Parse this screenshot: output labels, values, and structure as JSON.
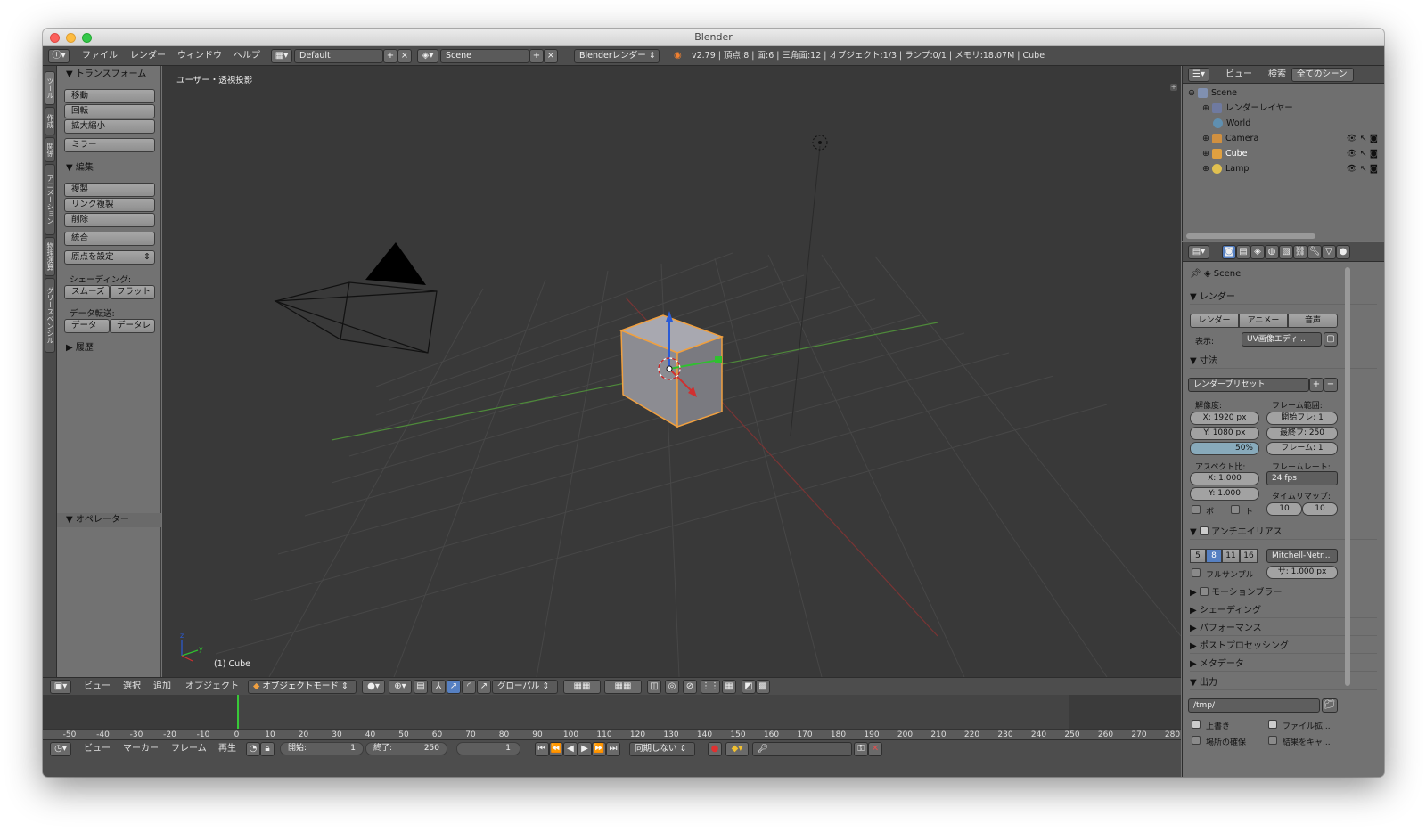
{
  "window": {
    "title": "Blender"
  },
  "header": {
    "menus": [
      "ファイル",
      "レンダー",
      "ウィンドウ",
      "ヘルプ"
    ],
    "layout": "Default",
    "scene": "Scene",
    "engine": "Blenderレンダー",
    "stats": "v2.79 | 頂点:8 | 面:6 | 三角面:12 | オブジェクト:1/3 | ランプ:0/1 | メモリ:18.07M | Cube"
  },
  "lefttabs": [
    "ツール",
    "作成",
    "関係",
    "アニメーション",
    "物理演算",
    "グリースペンシル"
  ],
  "tools": {
    "transform_header": "▼ トランスフォーム",
    "move": "移動",
    "rotate": "回転",
    "scale": "拡大縮小",
    "mirror": "ミラー",
    "edit_header": "▼ 編集",
    "duplicate": "複製",
    "link_duplicate": "リンク複製",
    "delete": "削除",
    "join": "統合",
    "set_origin": "原点を設定",
    "shading_label": "シェーディング:",
    "smooth": "スムーズ",
    "flat": "フラット",
    "data_transfer_label": "データ転送:",
    "data": "データ",
    "data_layout": "データレ",
    "history_header": "▶ 履歴",
    "operator_header": "▼ オペレーター"
  },
  "viewport": {
    "view_label": "ユーザー・透視投影",
    "object_label": "(1) Cube"
  },
  "view3d_header": {
    "menus": [
      "ビュー",
      "選択",
      "追加",
      "オブジェクト"
    ],
    "mode": "オブジェクトモード",
    "orientation": "グローバル"
  },
  "timeline": {
    "ruler": [
      "-50",
      "-40",
      "-30",
      "-20",
      "-10",
      "0",
      "10",
      "20",
      "30",
      "40",
      "50",
      "60",
      "70",
      "80",
      "90",
      "100",
      "110",
      "120",
      "130",
      "140",
      "150",
      "160",
      "170",
      "180",
      "190",
      "200",
      "210",
      "220",
      "230",
      "240",
      "250",
      "260",
      "270",
      "280"
    ],
    "menus": [
      "ビュー",
      "マーカー",
      "フレーム",
      "再生"
    ],
    "start_label": "開始:",
    "start_value": "1",
    "end_label": "終了:",
    "end_value": "250",
    "current": "1",
    "sync": "同期しない"
  },
  "outliner": {
    "menus": [
      "ビュー",
      "検索"
    ],
    "filter": "全てのシーン",
    "items": [
      "Scene",
      "レンダーレイヤー",
      "World",
      "Camera",
      "Cube",
      "Lamp"
    ]
  },
  "properties": {
    "context": "Scene",
    "render_header": "▼ レンダー",
    "render_btn": "レンダー",
    "anim_btn": "アニメー",
    "audio_btn": "音声",
    "display_label": "表示:",
    "display_value": "UV画像エディ...",
    "dimensions_header": "▼ 寸法",
    "render_preset": "レンダープリセット",
    "resolution_label": "解像度:",
    "res_x": "X:  1920 px",
    "res_y": "Y:  1080 px",
    "res_pct": "50%",
    "frame_range_label": "フレーム範囲:",
    "frame_start": "開始フレ:  1",
    "frame_end": "最終フ:  250",
    "frame_step": "フレーム:  1",
    "aspect_label": "アスペクト比:",
    "aspect_x": "X:  1.000",
    "aspect_y": "Y:  1.000",
    "framerate_label": "フレームレート:",
    "framerate": "24 fps",
    "timeremap_label": "タイムリマップ:",
    "remap_old": "10",
    "remap_new": "10",
    "border": "ボ",
    "crop": "ト",
    "aa_header": "アンチエイリアス",
    "aa_samples": [
      "5",
      "8",
      "11",
      "16"
    ],
    "aa_filter": "Mitchell-Netr...",
    "full_sample": "フルサンプル",
    "filter_size": "サ: 1.000 px",
    "motion_blur": "モーションブラー",
    "shading": "▶ シェーディング",
    "performance": "▶ パフォーマンス",
    "post": "▶ ポストプロセッシング",
    "metadata": "▶ メタデータ",
    "output_header": "▼ 出力",
    "output_path": "/tmp/",
    "overwrite": "上書き",
    "file_ext": "ファイル拡...",
    "placeholders": "場所の確保",
    "cache_result": "結果をキャ..."
  },
  "colors": {
    "accent": "#5680c2",
    "select": "#f0a040",
    "bg": "#393939"
  }
}
